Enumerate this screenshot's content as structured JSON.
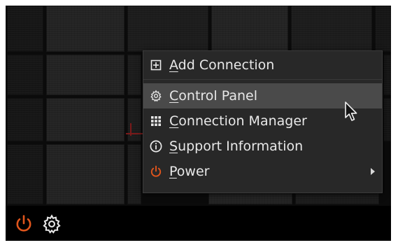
{
  "menu": {
    "items": [
      {
        "first": "A",
        "rest": "dd Connection",
        "icon": "add-box-icon"
      },
      {
        "first": "C",
        "rest": "ontrol Panel",
        "icon": "gear-icon"
      },
      {
        "first": "C",
        "rest": "onnection Manager",
        "icon": "grid-icon"
      },
      {
        "first": "S",
        "rest": "upport Information",
        "icon": "info-icon"
      },
      {
        "first": "P",
        "rest": "ower",
        "icon": "power-icon"
      }
    ],
    "hovered_index": 1
  },
  "taskbar": {
    "icons": [
      "power-icon",
      "gear-icon"
    ]
  },
  "colors": {
    "menu_bg": "#282828",
    "menu_hover": "#4a4a4a",
    "menu_text": "#e8e8e8",
    "power_orange": "#e0551c",
    "taskbar_bg": "#000000"
  }
}
